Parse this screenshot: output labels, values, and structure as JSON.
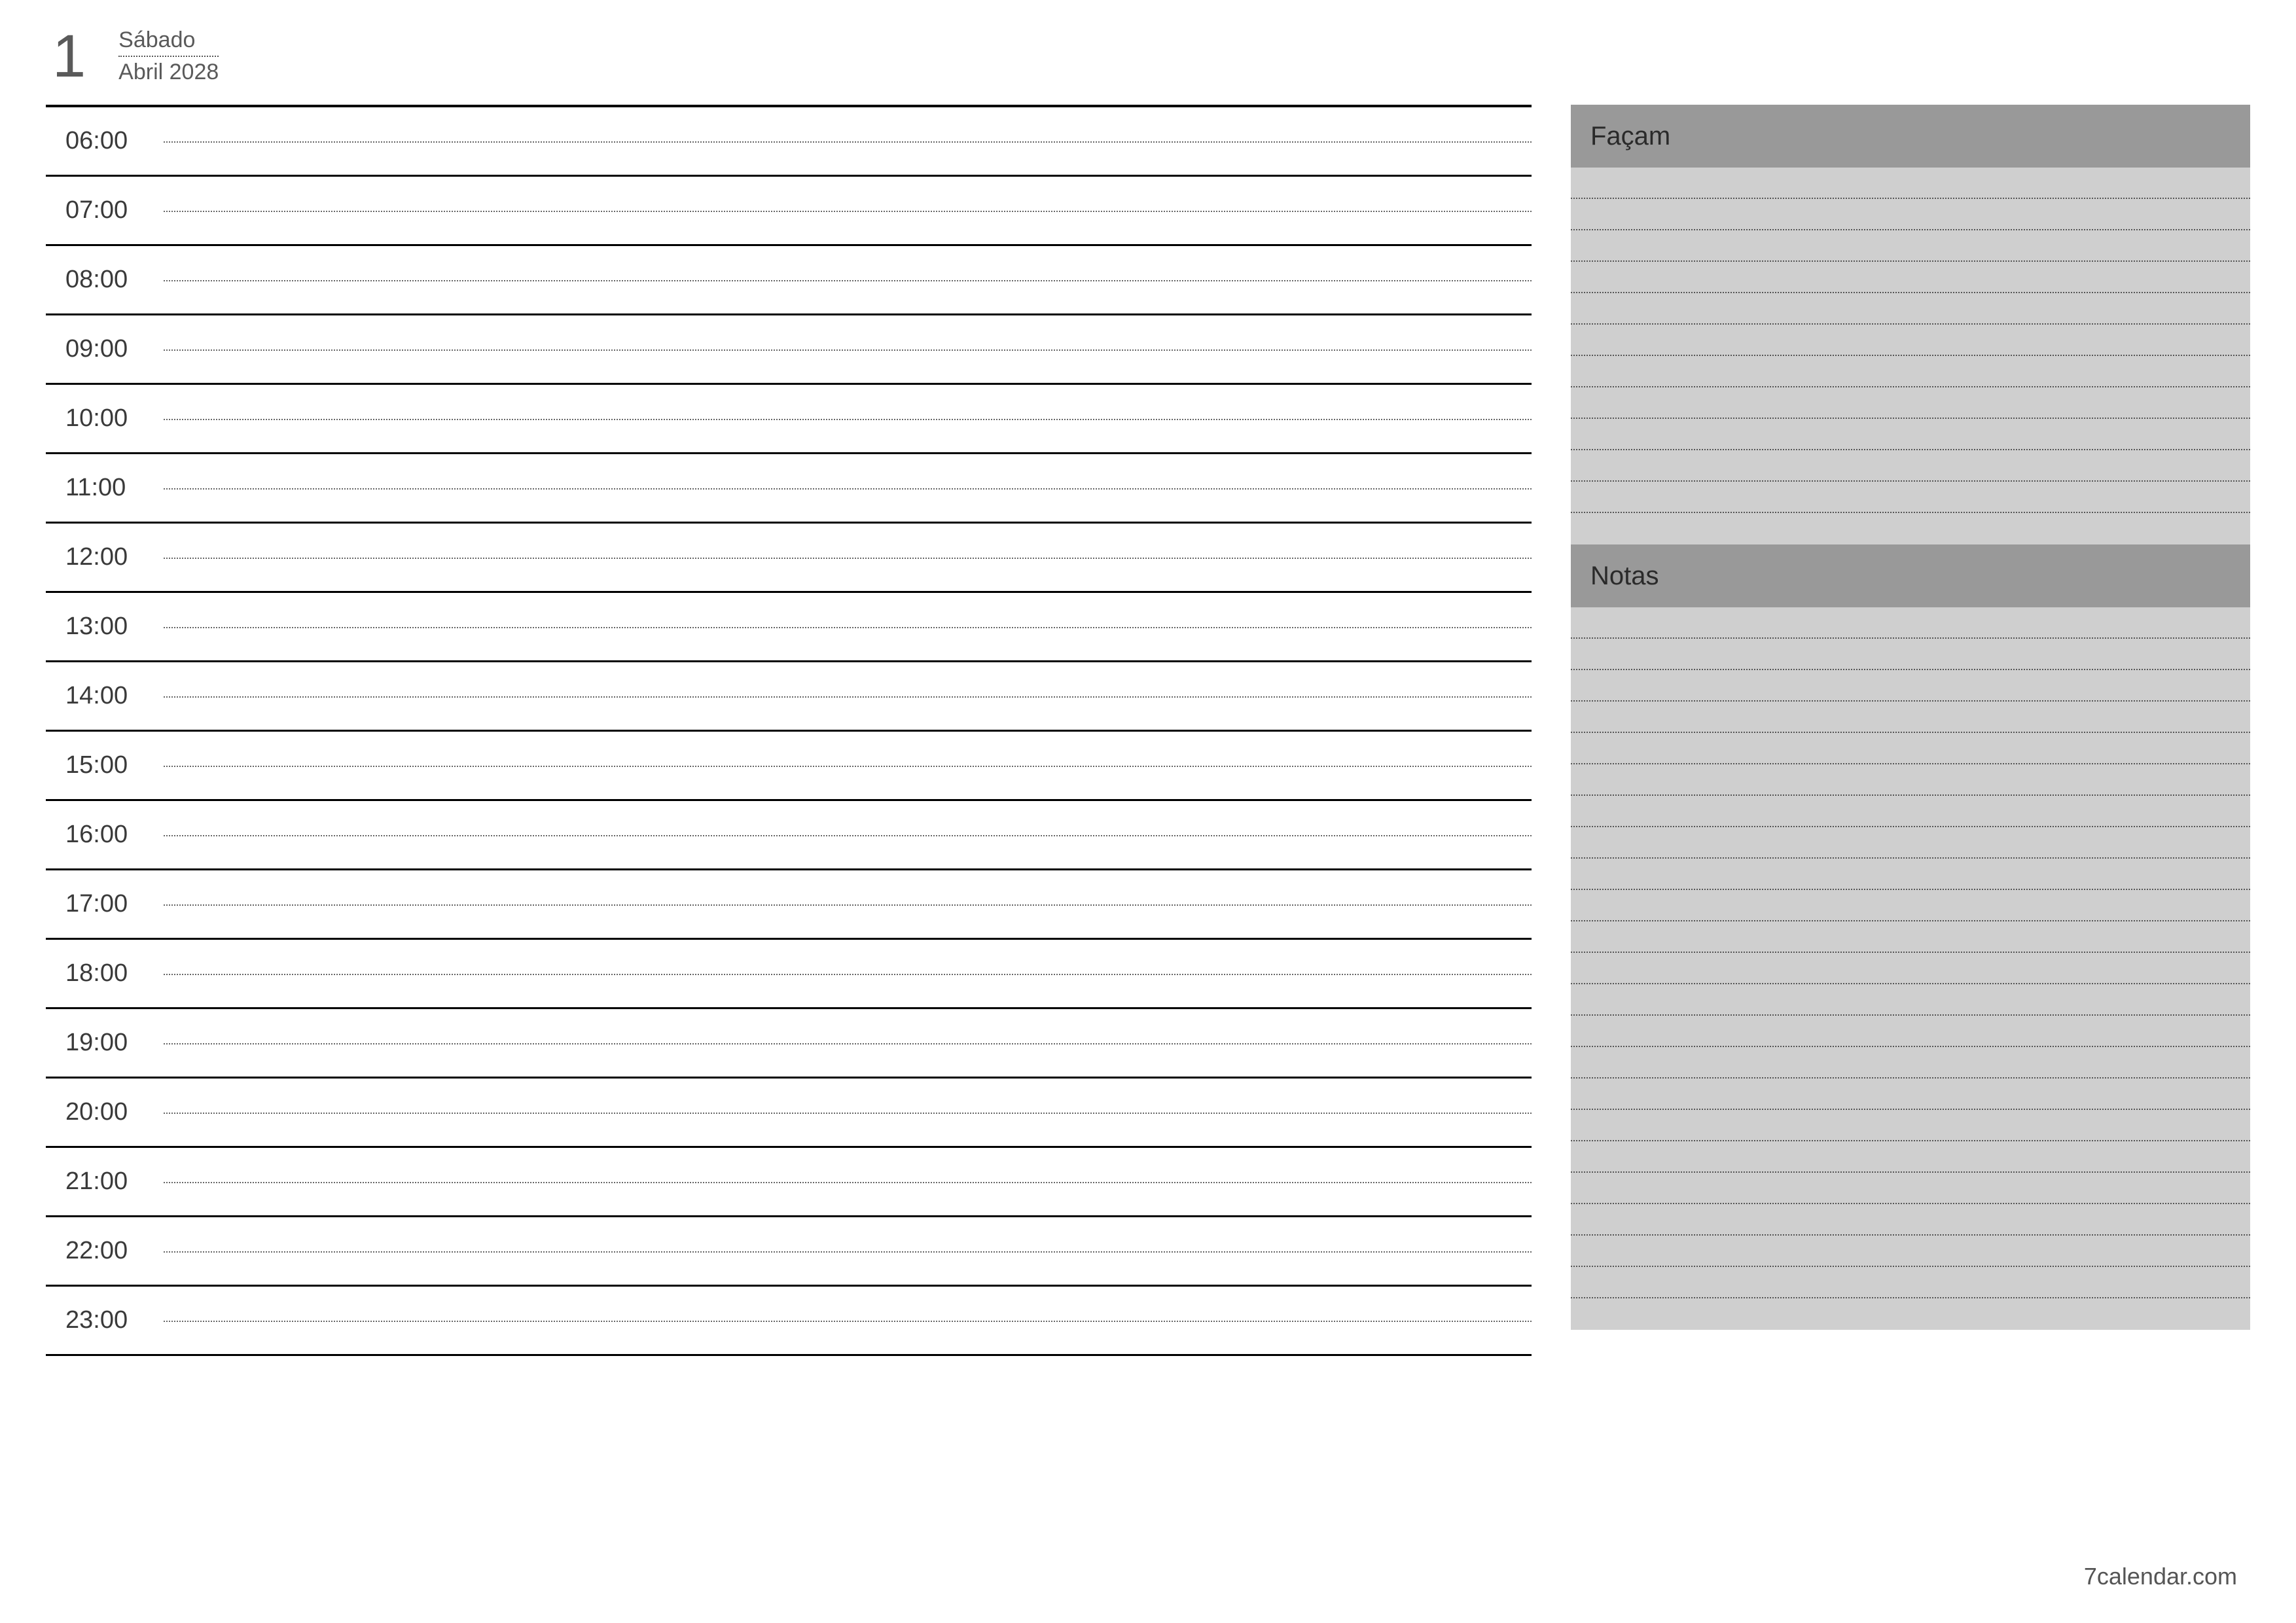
{
  "header": {
    "day_number": "1",
    "weekday": "Sábado",
    "month_year": "Abril 2028"
  },
  "schedule": {
    "hours": [
      "06:00",
      "07:00",
      "08:00",
      "09:00",
      "10:00",
      "11:00",
      "12:00",
      "13:00",
      "14:00",
      "15:00",
      "16:00",
      "17:00",
      "18:00",
      "19:00",
      "20:00",
      "21:00",
      "22:00",
      "23:00"
    ]
  },
  "sidebar": {
    "todo_title": "Façam",
    "todo_lines": 12,
    "notes_title": "Notas",
    "notes_lines": 23
  },
  "footer": {
    "source": "7calendar.com"
  }
}
